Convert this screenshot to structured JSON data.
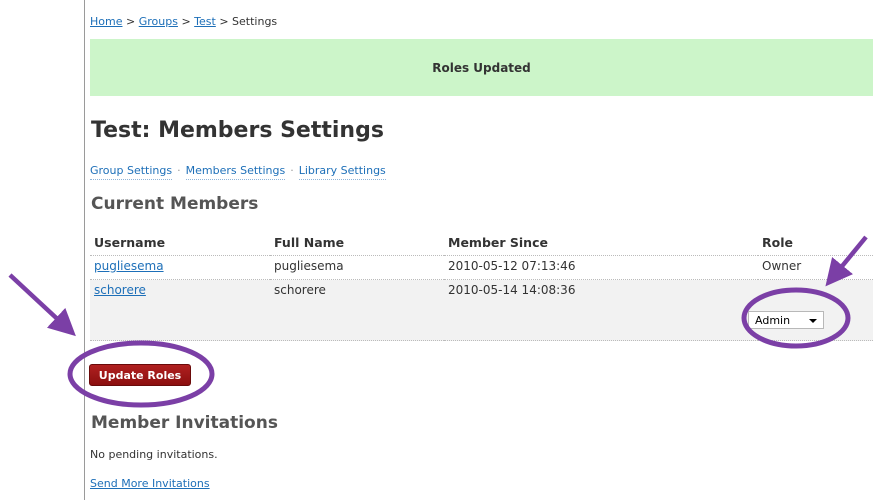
{
  "breadcrumb": {
    "home": "Home",
    "groups": "Groups",
    "test": "Test",
    "current": "Settings",
    "separator": ">"
  },
  "notice": {
    "text": "Roles Updated",
    "color": "#ccf5c9"
  },
  "page_title": "Test: Members Settings",
  "subnav": {
    "items": [
      "Group Settings",
      "Members Settings",
      "Library Settings"
    ],
    "separator": "·"
  },
  "current_members": {
    "title": "Current Members",
    "columns": [
      "Username",
      "Full Name",
      "Member Since",
      "Role"
    ],
    "rows": [
      {
        "username": "pugliesema",
        "full_name": "pugliesema",
        "member_since": "2010-05-12 07:13:46",
        "role": "Owner"
      },
      {
        "username": "schorere",
        "full_name": "schorere",
        "member_since": "2010-05-14 14:08:36",
        "role": "Admin"
      }
    ]
  },
  "update_button": {
    "label": "Update Roles",
    "color": "#9b1414"
  },
  "member_invitations": {
    "title": "Member Invitations",
    "empty_text": "No pending invitations.",
    "send_link": "Send More Invitations"
  },
  "annotation_color": "#7b3fa6"
}
